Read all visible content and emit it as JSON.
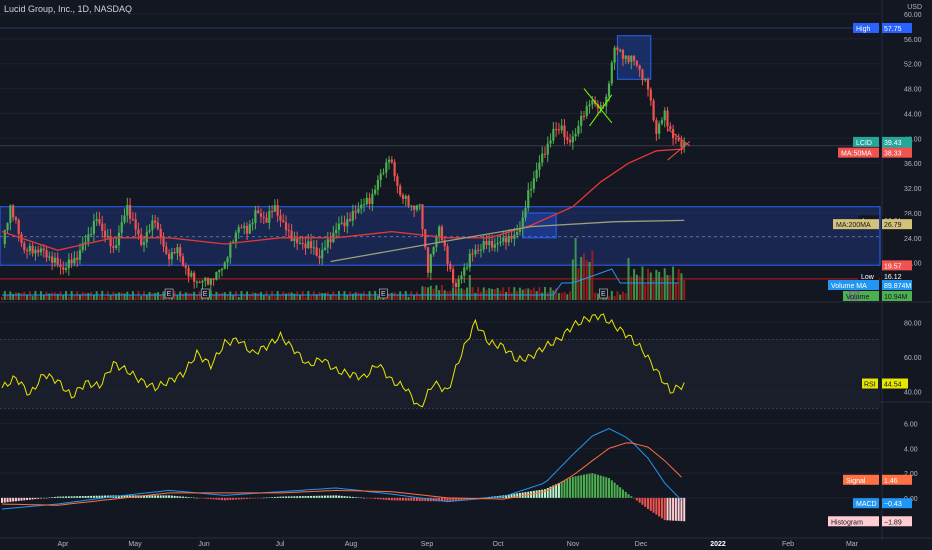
{
  "header": {
    "title": "Lucid Group, Inc., 1D, NASDAQ",
    "currency": "USD"
  },
  "colors": {
    "bg": "#131722",
    "grid": "#1e222d",
    "up": "#26a69a",
    "upBright": "#4caf50",
    "down": "#ef5350",
    "ma50": "#e53935",
    "ma200": "#9e9e7a",
    "rsi": "#e6e600",
    "macd": "#2196f3",
    "signal": "#ff7043",
    "band": "#1e3a8a",
    "text": "#b2b5be"
  },
  "chart_data": [
    {
      "type": "candlestick",
      "title": "Lucid Group, Inc., 1D, NASDAQ",
      "ylim": [
        14,
        60
      ],
      "y_ticks": [
        "60.00",
        "56.00",
        "52.00",
        "48.00",
        "44.00",
        "40.00",
        "36.00",
        "32.00",
        "28.00",
        "24.00",
        "20.00"
      ],
      "x_ticks": [
        "Apr",
        "May",
        "Jun",
        "Jul",
        "Aug",
        "Sep",
        "Oct",
        "Nov",
        "Dec",
        "2022",
        "Feb",
        "Mar"
      ],
      "price_path": [
        [
          0,
          23
        ],
        [
          3,
          29
        ],
        [
          8,
          22
        ],
        [
          14,
          22
        ],
        [
          22,
          19
        ],
        [
          27,
          21
        ],
        [
          34,
          27
        ],
        [
          40,
          22
        ],
        [
          45,
          29
        ],
        [
          50,
          23
        ],
        [
          55,
          27
        ],
        [
          59,
          21
        ],
        [
          63,
          22
        ],
        [
          67,
          18
        ],
        [
          70,
          17
        ],
        [
          74,
          17
        ],
        [
          77,
          18
        ],
        [
          80,
          20
        ],
        [
          85,
          26
        ],
        [
          88,
          25
        ],
        [
          91,
          28
        ],
        [
          95,
          27
        ],
        [
          98,
          29
        ],
        [
          101,
          26
        ],
        [
          106,
          23
        ],
        [
          110,
          23
        ],
        [
          114,
          21
        ],
        [
          118,
          24
        ],
        [
          121,
          26
        ],
        [
          125,
          27
        ],
        [
          128,
          29
        ],
        [
          132,
          30
        ],
        [
          136,
          34
        ],
        [
          139,
          37
        ],
        [
          143,
          31
        ],
        [
          147,
          29
        ],
        [
          150,
          29
        ],
        [
          153,
          19
        ],
        [
          157,
          26
        ],
        [
          160,
          20
        ],
        [
          163,
          16
        ],
        [
          168,
          21
        ],
        [
          173,
          23
        ],
        [
          178,
          23
        ],
        [
          181,
          24
        ],
        [
          184,
          24
        ],
        [
          187,
          27
        ],
        [
          189,
          31
        ],
        [
          192,
          35
        ],
        [
          195,
          38
        ],
        [
          198,
          41
        ],
        [
          201,
          42
        ],
        [
          203,
          39
        ],
        [
          206,
          41
        ],
        [
          209,
          44
        ],
        [
          211,
          46
        ],
        [
          214,
          45
        ],
        [
          217,
          46
        ],
        [
          220,
          55
        ],
        [
          223,
          53
        ],
        [
          226,
          53
        ],
        [
          229,
          51
        ],
        [
          232,
          48
        ],
        [
          235,
          41
        ],
        [
          238,
          44
        ],
        [
          241,
          40
        ],
        [
          245,
          39
        ]
      ],
      "series": [
        {
          "name": "MA:50MA",
          "values": [
            [
              0,
              25
            ],
            [
              20,
              22
            ],
            [
              40,
              24
            ],
            [
              60,
              24
            ],
            [
              80,
              23
            ],
            [
              100,
              24
            ],
            [
              120,
              24
            ],
            [
              140,
              25
            ],
            [
              160,
              24
            ],
            [
              175,
              24
            ],
            [
              190,
              26
            ],
            [
              205,
              29
            ],
            [
              215,
              33
            ],
            [
              225,
              36
            ],
            [
              235,
              38
            ],
            [
              245,
              38.3
            ]
          ]
        },
        {
          "name": "MA:200MA",
          "values": [
            [
              118,
              20.2
            ],
            [
              160,
              23.5
            ],
            [
              190,
              25.8
            ],
            [
              220,
              26.6
            ],
            [
              245,
              26.8
            ]
          ]
        }
      ],
      "annotations": [
        {
          "label": "High",
          "value": "57.75",
          "color": "#2962ff"
        },
        {
          "label": "LCID",
          "value": "39.43",
          "sub": "05:59:45",
          "color": "#26a69a"
        },
        {
          "label": "MA:50MA",
          "value": "38.33",
          "color": "#ef5350"
        },
        {
          "label": "Avg",
          "value": "26.81",
          "color": "#131722"
        },
        {
          "label": "MA:200MA",
          "value": "26.79",
          "color": "#d4c17a"
        },
        {
          "label": "",
          "value": "19.57",
          "color": "#ef5350"
        },
        {
          "label": "",
          "value": "17.42",
          "color": "#ef5350"
        },
        {
          "label": "Low",
          "value": "16.12",
          "color": "#131722"
        },
        {
          "label": "Volume MA",
          "value": "89.874M",
          "color": "#2196f3"
        },
        {
          "label": "Volume",
          "value": "10.94M",
          "color": "#4caf50"
        }
      ],
      "earnings_markers": [
        "E",
        "E",
        "E",
        "E"
      ]
    },
    {
      "type": "line",
      "title": "RSI",
      "ylim": [
        35,
        90
      ],
      "y_ticks": [
        "80.00",
        "60.00",
        "40.00"
      ],
      "series": [
        {
          "name": "RSI",
          "values": [
            [
              0,
              42
            ],
            [
              5,
              48
            ],
            [
              10,
              38
            ],
            [
              15,
              50
            ],
            [
              20,
              46
            ],
            [
              25,
              37
            ],
            [
              30,
              45
            ],
            [
              35,
              43
            ],
            [
              40,
              56
            ],
            [
              45,
              52
            ],
            [
              50,
              46
            ],
            [
              55,
              42
            ],
            [
              60,
              46
            ],
            [
              65,
              50
            ],
            [
              70,
              62
            ],
            [
              75,
              55
            ],
            [
              80,
              68
            ],
            [
              85,
              70
            ],
            [
              90,
              62
            ],
            [
              95,
              66
            ],
            [
              100,
              72
            ],
            [
              105,
              64
            ],
            [
              110,
              55
            ],
            [
              115,
              59
            ],
            [
              120,
              52
            ],
            [
              125,
              50
            ],
            [
              130,
              48
            ],
            [
              135,
              56
            ],
            [
              140,
              46
            ],
            [
              145,
              42
            ],
            [
              150,
              30
            ],
            [
              155,
              45
            ],
            [
              160,
              40
            ],
            [
              165,
              62
            ],
            [
              170,
              80
            ],
            [
              175,
              68
            ],
            [
              180,
              66
            ],
            [
              185,
              58
            ],
            [
              190,
              60
            ],
            [
              195,
              66
            ],
            [
              200,
              70
            ],
            [
              205,
              78
            ],
            [
              210,
              82
            ],
            [
              215,
              84
            ],
            [
              220,
              78
            ],
            [
              225,
              72
            ],
            [
              230,
              64
            ],
            [
              235,
              52
            ],
            [
              240,
              40
            ],
            [
              245,
              44
            ]
          ]
        }
      ],
      "value_label": {
        "label": "RSI",
        "value": "44.54"
      }
    },
    {
      "type": "line",
      "title": "MACD",
      "ylim": [
        -3,
        7.5
      ],
      "y_ticks": [
        "6.00",
        "4.00",
        "2.00",
        "0.00"
      ],
      "series": [
        {
          "name": "MACD",
          "values": [
            [
              0,
              -0.9
            ],
            [
              20,
              -0.5
            ],
            [
              40,
              0.1
            ],
            [
              60,
              0.6
            ],
            [
              80,
              0.2
            ],
            [
              100,
              0.5
            ],
            [
              120,
              0.8
            ],
            [
              140,
              0.3
            ],
            [
              160,
              -0.3
            ],
            [
              180,
              0.1
            ],
            [
              195,
              1.2
            ],
            [
              205,
              3.5
            ],
            [
              212,
              5
            ],
            [
              218,
              5.6
            ],
            [
              225,
              4.8
            ],
            [
              232,
              3.2
            ],
            [
              238,
              1.2
            ],
            [
              245,
              -0.43
            ]
          ]
        },
        {
          "name": "Signal",
          "values": [
            [
              0,
              -0.5
            ],
            [
              20,
              -0.6
            ],
            [
              40,
              -0.1
            ],
            [
              60,
              0.4
            ],
            [
              80,
              0.4
            ],
            [
              100,
              0.4
            ],
            [
              120,
              0.6
            ],
            [
              140,
              0.5
            ],
            [
              160,
              0
            ],
            [
              180,
              -0.1
            ],
            [
              195,
              0.5
            ],
            [
              205,
              1.8
            ],
            [
              212,
              3
            ],
            [
              218,
              4
            ],
            [
              225,
              4.5
            ],
            [
              232,
              4.1
            ],
            [
              238,
              3
            ],
            [
              245,
              1.46
            ]
          ]
        }
      ],
      "value_labels": [
        {
          "label": "Signal",
          "value": "1.46",
          "color": "#ff7043"
        },
        {
          "label": "MACD",
          "value": "−0.43",
          "color": "#2196f3"
        },
        {
          "label": "Histogram",
          "value": "−1.89",
          "color": "#ffcdd2"
        }
      ]
    }
  ]
}
